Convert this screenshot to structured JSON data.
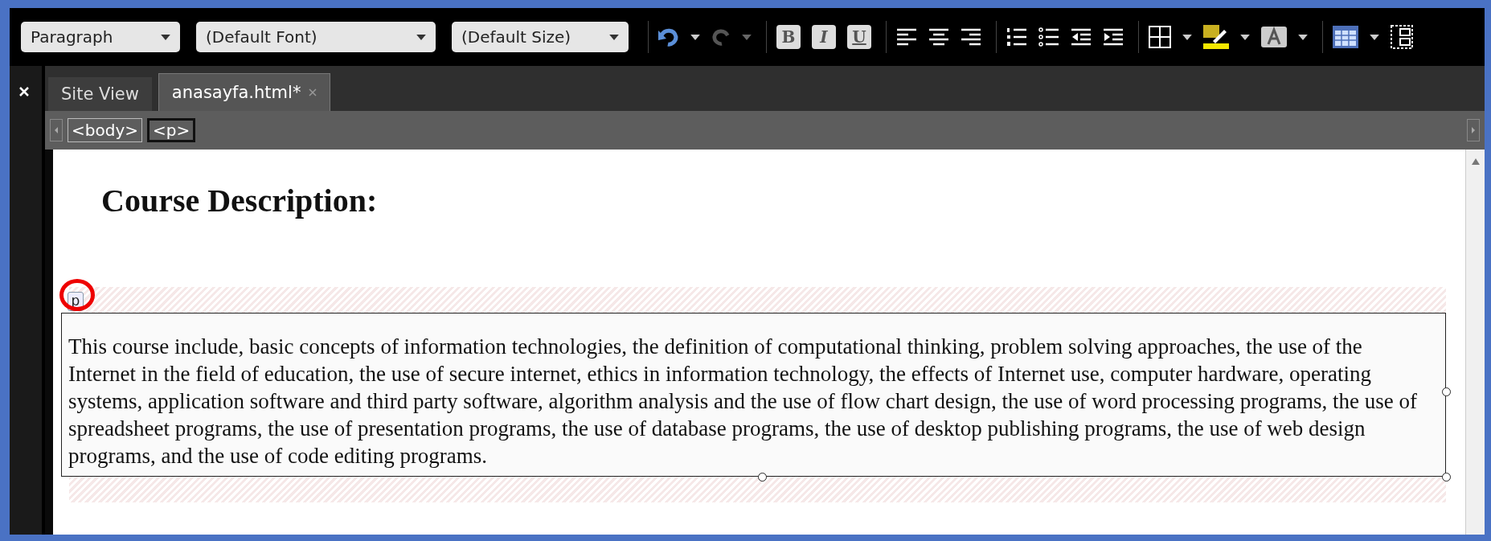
{
  "toolbar": {
    "dropdowns": [
      {
        "label": "Paragraph"
      },
      {
        "label": "(Default Font)"
      },
      {
        "label": "(Default Size)"
      }
    ],
    "format_buttons": [
      "B",
      "I",
      "U"
    ]
  },
  "tabs": [
    {
      "label": "Site View",
      "selected": false,
      "closable": false
    },
    {
      "label": "anasayfa.html*",
      "selected": true,
      "closable": true
    }
  ],
  "breadcrumb": [
    {
      "label": "<body>",
      "selected": false
    },
    {
      "label": "<p>",
      "selected": true
    }
  ],
  "heading": "Course Description:",
  "tag_marker": "p",
  "paragraph": "This course include, basic concepts of information technologies, the definition of computational thinking, problem solving approaches, the use of the Internet in the field of education, the use of secure internet, ethics in information technology, the effects of Internet use, computer hardware, operating systems, application software and third party software, algorithm analysis and the use of flow chart design, the use of word processing programs, the use of spreadsheet programs, the use of presentation programs, the use of database programs, the use of desktop publishing programs, the use of web design programs, and the use of code editing programs."
}
